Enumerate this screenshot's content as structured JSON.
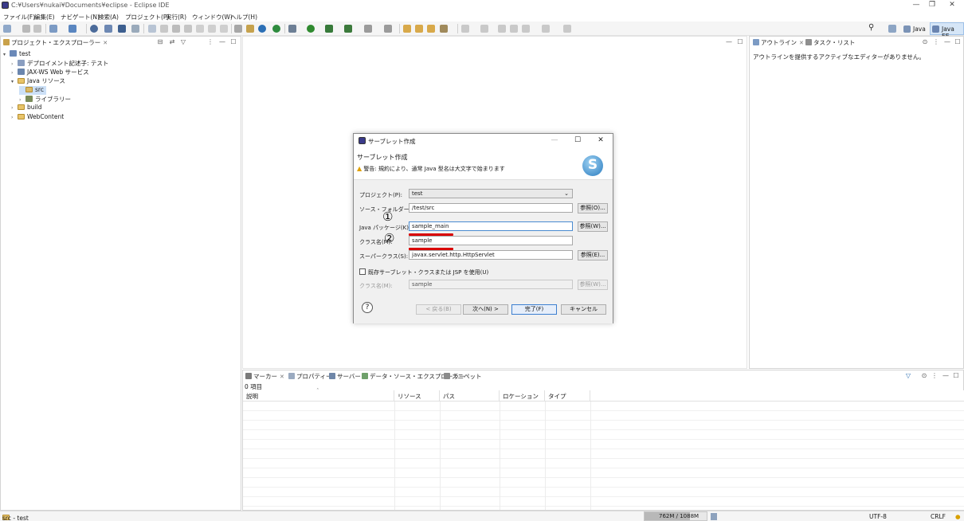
{
  "window": {
    "title": "C:¥Users¥nukai¥Documents¥eclipse - Eclipse IDE",
    "minimize": "—",
    "restore": "❐",
    "close": "✕"
  },
  "menu": [
    "ファイル(F)",
    "編集(E)",
    "ナビゲート(N)",
    "検索(A)",
    "プロジェクト(P)",
    "実行(R)",
    "ウィンドウ(W)",
    "ヘルプ(H)"
  ],
  "perspectives": {
    "java": "Java",
    "javaee": "Java EE"
  },
  "project_explorer": {
    "tab_label": "プロジェクト・エクスプローラー",
    "tree": [
      {
        "label": "test"
      },
      {
        "label": "デプロイメント記述子: テスト"
      },
      {
        "label": "JAX-WS Web サービス"
      },
      {
        "label": "Java リソース"
      },
      {
        "label": "src"
      },
      {
        "label": "ライブラリー"
      },
      {
        "label": "build"
      },
      {
        "label": "WebContent"
      }
    ]
  },
  "outline": {
    "tab_label": "アウトライン",
    "tab2_label": "タスク・リスト",
    "message": "アウトラインを提供するアクティブなエディターがありません。"
  },
  "bottom_panel": {
    "tabs": [
      "マーカー",
      "プロパティー",
      "サーバー",
      "データ・ソース・エクスプローラー",
      "スニペット"
    ],
    "item_count": "0 項目",
    "columns": [
      "説明",
      "リソース",
      "パス",
      "ロケーション",
      "タイプ"
    ]
  },
  "dialog": {
    "title": "サーブレット作成",
    "minimize": "—",
    "maximize": "☐",
    "close": "✕",
    "heading": "サーブレット作成",
    "warning": "警告: 規約により、通常 Java 型名は大文字で始まります",
    "project_label": "プロジェクト(P):",
    "project_value": "test",
    "source_folder_label": "ソース・フォルダー(D):",
    "source_folder_value": "/test/src",
    "browse_label": "参照(O)...",
    "package_label": "Java パッケージ(K):",
    "package_value": "sample_main",
    "browse_pkg_label": "参照(W)...",
    "class_label": "クラス名(M):",
    "class_value": "sample",
    "superclass_label": "スーパークラス(S):",
    "superclass_value": "javax.servlet.http.HttpServlet",
    "browse_super_label": "参照(E)...",
    "existing_checkbox_label": "既存サーブレット・クラスまたは JSP を使用(U)",
    "existing_class_label": "クラス名(M):",
    "existing_class_value": "sample",
    "browse_existing_label": "参照(W)...",
    "help": "?",
    "back_button": "< 戻る(B)",
    "next_button": "次へ(N) >",
    "finish_button": "完了(F)",
    "cancel_button": "キャンセル"
  },
  "annotations": {
    "mark1": "①",
    "mark2": "②",
    "color": "#d90000"
  },
  "status": {
    "selection": "src - test",
    "heap": "762M / 1088M",
    "encoding": "UTF-8",
    "line_delimiter": "CRLF"
  }
}
